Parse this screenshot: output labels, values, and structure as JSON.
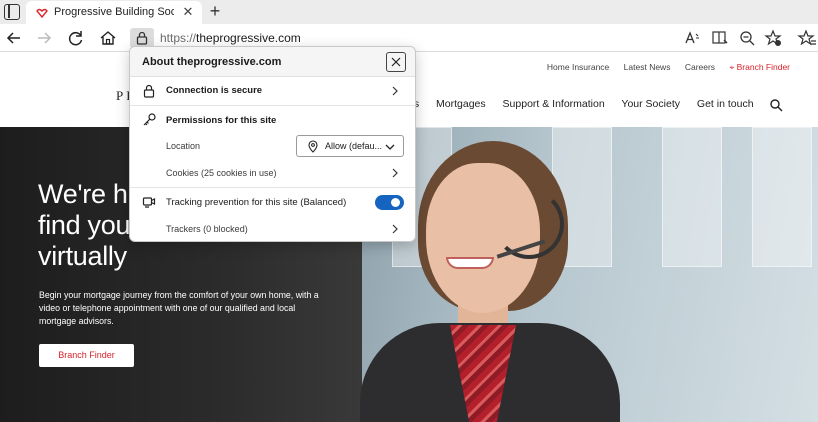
{
  "browser": {
    "tab": {
      "title": "Progressive Building Society - M",
      "close": "✕"
    },
    "new_tab": "+",
    "address": {
      "protocol": "https://",
      "host": "theprogressive.com"
    }
  },
  "site": {
    "top_links": [
      "Home Insurance",
      "Latest News",
      "Careers",
      "Branch Finder"
    ],
    "logo_text": "PR",
    "nav": [
      "gs",
      "Mortgages",
      "Support & Information",
      "Your Society",
      "Get in touch"
    ],
    "hero": {
      "heading_lines": [
        "We're h",
        "find you",
        "virtually"
      ],
      "paragraph": "Begin your mortgage journey from the comfort of your own home, with a video or telephone appointment with one of our qualified and local mortgage advisors.",
      "button": "Branch Finder"
    }
  },
  "popup": {
    "title": "About theprogressive.com",
    "connection": "Connection is secure",
    "permissions": "Permissions for this site",
    "location_label": "Location",
    "location_value": "Allow (defau...",
    "cookies": "Cookies (25 cookies in use)",
    "tracking": "Tracking prevention for this site (Balanced)",
    "tracking_on": true,
    "trackers": "Trackers (0 blocked)"
  },
  "colors": {
    "accent": "#1565c0",
    "brand_red": "#d8232a"
  },
  "icons": {
    "tab_favicon": "progressive-logo-icon",
    "lock": "lock-icon",
    "key": "key-icon",
    "location": "location-pin-icon",
    "tracking": "tracking-prevention-icon"
  }
}
